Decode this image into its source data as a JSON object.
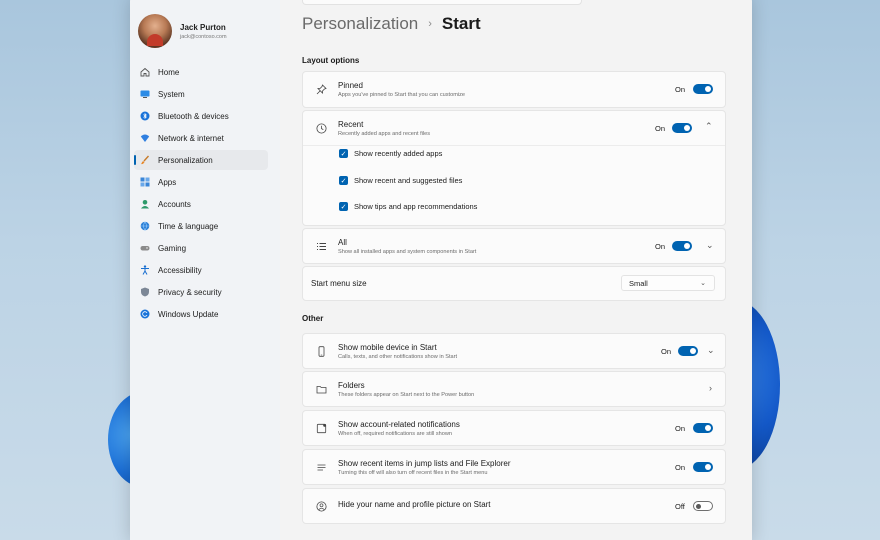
{
  "user": {
    "name": "Jack Purton",
    "email": "jack@contoso.com"
  },
  "sidebar": {
    "items": [
      {
        "label": "Home",
        "icon": "home-icon"
      },
      {
        "label": "System",
        "icon": "system-icon"
      },
      {
        "label": "Bluetooth & devices",
        "icon": "bluetooth-icon"
      },
      {
        "label": "Network & internet",
        "icon": "network-icon"
      },
      {
        "label": "Personalization",
        "icon": "brush-icon",
        "active": true
      },
      {
        "label": "Apps",
        "icon": "apps-icon"
      },
      {
        "label": "Accounts",
        "icon": "accounts-icon"
      },
      {
        "label": "Time & language",
        "icon": "globe-icon"
      },
      {
        "label": "Gaming",
        "icon": "gamepad-icon"
      },
      {
        "label": "Accessibility",
        "icon": "accessibility-icon"
      },
      {
        "label": "Privacy & security",
        "icon": "shield-icon"
      },
      {
        "label": "Windows Update",
        "icon": "update-icon"
      }
    ]
  },
  "breadcrumb": {
    "parent": "Personalization",
    "current": "Start"
  },
  "layout_options": {
    "title": "Layout options",
    "pinned": {
      "title": "Pinned",
      "desc": "Apps you've pinned to Start that you can customize",
      "state": "On"
    },
    "recent": {
      "title": "Recent",
      "desc": "Recently added apps and recent files",
      "state": "On",
      "checks": [
        "Show recently added apps",
        "Show recent and suggested files",
        "Show tips and app recommendations"
      ]
    },
    "all": {
      "title": "All",
      "desc": "Show all installed apps and system components in Start",
      "state": "On"
    },
    "menu_size": {
      "title": "Start menu size",
      "value": "Small"
    }
  },
  "other": {
    "title": "Other",
    "mobile": {
      "title": "Show mobile device in Start",
      "desc": "Calls, texts, and other notifications show in Start",
      "state": "On"
    },
    "folders": {
      "title": "Folders",
      "desc": "These folders appear on Start next to the Power button"
    },
    "account_notif": {
      "title": "Show account-related notifications",
      "desc": "When off, required notifications are still shown",
      "state": "On"
    },
    "jump_lists": {
      "title": "Show recent items in jump lists and File Explorer",
      "desc": "Turning this off will also turn off recent files in the Start menu",
      "state": "On"
    },
    "hide_name": {
      "title": "Hide your name and profile picture on Start",
      "state": "Off"
    }
  },
  "colors": {
    "accent": "#0063b1"
  }
}
